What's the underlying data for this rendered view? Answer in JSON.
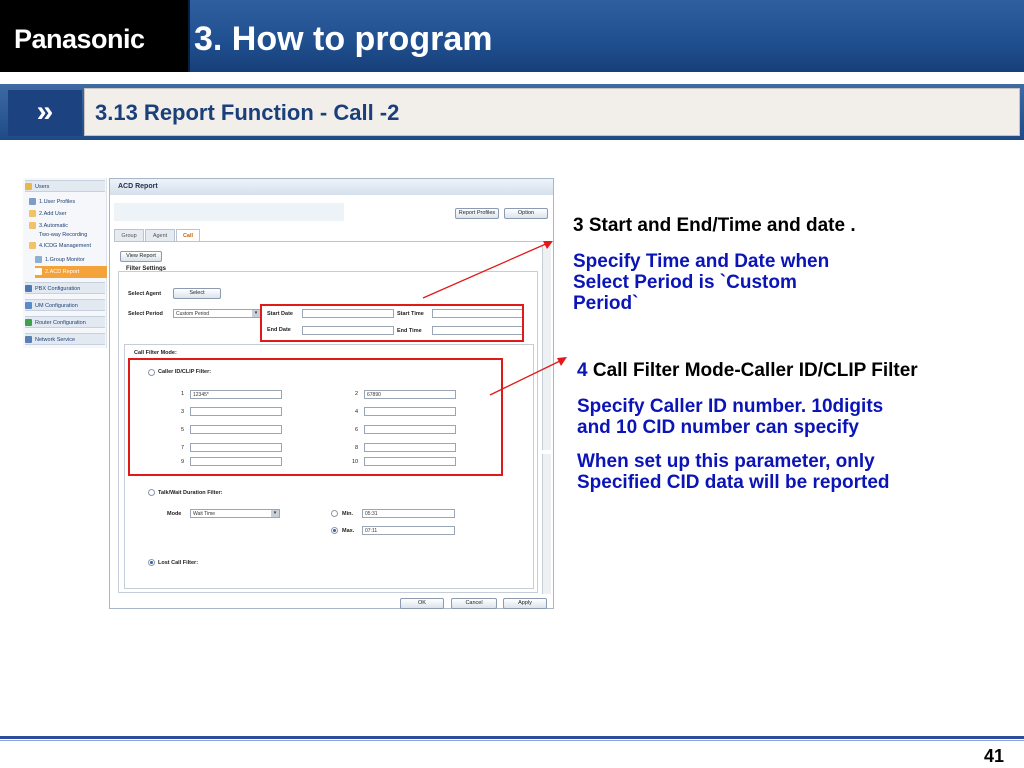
{
  "header": {
    "logo": "Panasonic",
    "title": "3. How to program",
    "subtitle_arrow": "»",
    "subtitle": "3.13 Report Function  -  Call -2"
  },
  "sidebar": {
    "items": [
      {
        "label": "Users",
        "type": "head"
      },
      {
        "label": "1.User Profiles"
      },
      {
        "label": "2.Add User"
      },
      {
        "label": "3.Automatic"
      },
      {
        "label": "Two-way Recording"
      },
      {
        "label": "4.ICDG Management"
      },
      {
        "label": "1.Group Monitor"
      },
      {
        "label": "2.ACD Report",
        "selected": true
      },
      {
        "label": "PBX Configuration",
        "type": "head"
      },
      {
        "label": "UM Configuration",
        "type": "head"
      },
      {
        "label": "Router Configuration",
        "type": "head"
      },
      {
        "label": "Network Service",
        "type": "head"
      }
    ]
  },
  "acd": {
    "title": "ACD Report",
    "report_profiles": "Report Profiles",
    "option": "Option",
    "tabs": [
      "Group",
      "Agent",
      "Call"
    ],
    "view_report": "View Report",
    "filter_settings": "Filter Settings",
    "select_agent": "Select Agent",
    "select_btn": "Select",
    "select_period": "Select Period",
    "period_value": "Custom Period",
    "start_date": "Start Date",
    "start_time": "Start Time",
    "end_date": "End Date",
    "end_time": "End Time",
    "call_filter_mode": "Call Filter Mode:",
    "caller_id_filter": "Caller ID/CLIP Filter:",
    "cid": [
      {
        "n": "1",
        "v": "12345*"
      },
      {
        "n": "2",
        "v": "67890"
      },
      {
        "n": "3",
        "v": ""
      },
      {
        "n": "4",
        "v": ""
      },
      {
        "n": "5",
        "v": ""
      },
      {
        "n": "6",
        "v": ""
      },
      {
        "n": "7",
        "v": ""
      },
      {
        "n": "8",
        "v": ""
      },
      {
        "n": "9",
        "v": ""
      },
      {
        "n": "10",
        "v": ""
      }
    ],
    "talk_wait_filter": "Talk/Wait Duration Filter:",
    "mode": "Mode",
    "mode_value": "Wait Time",
    "min": "Min.",
    "min_value": "05:31",
    "max": "Max.",
    "max_value": "07:11",
    "lost_call_filter": "Lost Call Filter:",
    "ok": "OK",
    "cancel": "Cancel",
    "apply": "Apply"
  },
  "notes": {
    "n3_title": "3 Start and End/Time and date .",
    "n3_l1": "Specify Time and Date when",
    "n3_l2": "Select Period is `Custom",
    "n3_l3": "Period`",
    "n4_num": "4",
    "n4_title": " Call Filter Mode-Caller ID/CLIP Filter",
    "n4_l1": "Specify Caller ID number.  10digits",
    "n4_l2": "and 10 CID number can specify",
    "n4_l3": "When set up this parameter, only",
    "n4_l4": "Specified CID data will be reported"
  },
  "page_number": "41",
  "colors": {
    "brand_blue": "#1f4f8f",
    "annotation_blue": "#0b14b6",
    "highlight_red": "#e11919",
    "selected_orange": "#f4a23a"
  }
}
